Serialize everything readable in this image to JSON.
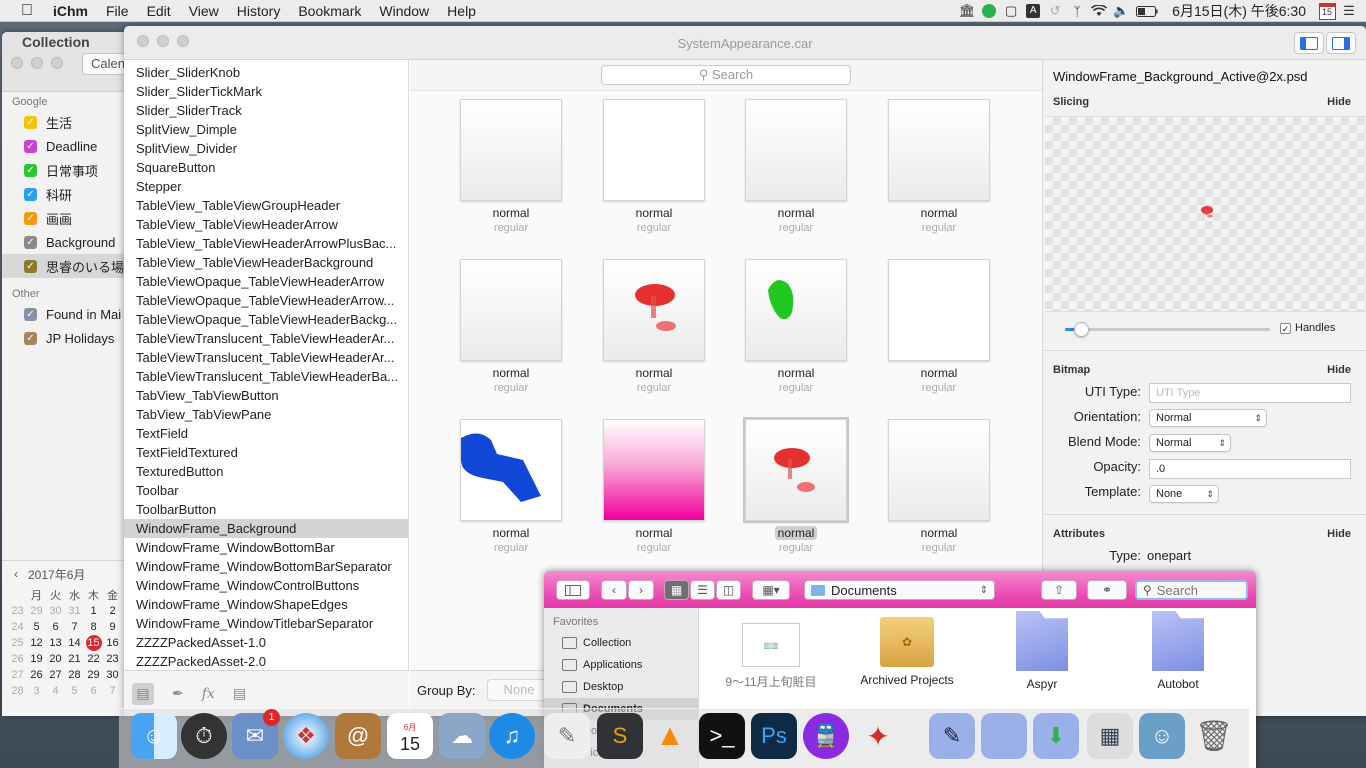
{
  "menubar": {
    "app_name": "iChm",
    "items": [
      "File",
      "Edit",
      "View",
      "History",
      "Bookmark",
      "Window",
      "Help"
    ],
    "clock": "6月15日(木) 午後6:30",
    "calendar_day": "15"
  },
  "calendar": {
    "collection_label": "Collection",
    "toolbar_button": "Calen",
    "google_group": "Google",
    "google_items": [
      {
        "label": "生活",
        "color": "#f5c400"
      },
      {
        "label": "Deadline",
        "color": "#c643d4"
      },
      {
        "label": "日常事项",
        "color": "#2ec42e"
      },
      {
        "label": "科研",
        "color": "#2b9ef0"
      },
      {
        "label": "画画",
        "color": "#f59a0c"
      },
      {
        "label": "Background",
        "color": "#8a8a8a"
      },
      {
        "label": "思睿のいる場所",
        "color": "#8a7a2a"
      }
    ],
    "other_group": "Other",
    "other_items": [
      {
        "label": "Found in Mai",
        "color": "#8a8fa8"
      },
      {
        "label": "JP Holidays",
        "color": "#a7845a"
      }
    ],
    "month_label": "2017年6月",
    "weekdays": [
      "月",
      "火",
      "水",
      "木",
      "金"
    ],
    "weeks": [
      [
        "29",
        "30",
        "31",
        "1",
        "2"
      ],
      [
        "5",
        "6",
        "7",
        "8",
        "9"
      ],
      [
        "12",
        "13",
        "14",
        "15",
        "16"
      ],
      [
        "19",
        "20",
        "21",
        "22",
        "23"
      ],
      [
        "26",
        "27",
        "28",
        "29",
        "30"
      ],
      [
        "3",
        "4",
        "5",
        "6",
        "7"
      ]
    ],
    "week_numbers": [
      "23",
      "24",
      "25",
      "26",
      "27",
      "28"
    ],
    "today": "15"
  },
  "window": {
    "title": "SystemAppearance.car",
    "search_placeholder": "Search",
    "assets": [
      "Slider_SliderKnob",
      "Slider_SliderTickMark",
      "Slider_SliderTrack",
      "SplitView_Dimple",
      "SplitView_Divider",
      "SquareButton",
      "Stepper",
      "TableView_TableViewGroupHeader",
      "TableView_TableViewHeaderArrow",
      "TableView_TableViewHeaderArrowPlusBac...",
      "TableView_TableViewHeaderBackground",
      "TableViewOpaque_TableViewHeaderArrow",
      "TableViewOpaque_TableViewHeaderArrow...",
      "TableViewOpaque_TableViewHeaderBackg...",
      "TableViewTranslucent_TableViewHeaderAr...",
      "TableViewTranslucent_TableViewHeaderAr...",
      "TableViewTranslucent_TableViewHeaderBa...",
      "TabView_TabViewButton",
      "TabView_TabViewPane",
      "TextField",
      "TextFieldTextured",
      "TexturedButton",
      "Toolbar",
      "ToolbarButton",
      "WindowFrame_Background",
      "WindowFrame_WindowBottomBar",
      "WindowFrame_WindowBottomBarSeparator",
      "WindowFrame_WindowControlButtons",
      "WindowFrame_WindowShapeEdges",
      "WindowFrame_WindowTitlebarSeparator",
      "ZZZZPackedAsset-1.0",
      "ZZZZPackedAsset-2.0"
    ],
    "selected_asset": "WindowFrame_Background",
    "grid": [
      {
        "name": "normal",
        "sub": "regular",
        "kind": "grad"
      },
      {
        "name": "normal",
        "sub": "regular",
        "kind": "white"
      },
      {
        "name": "normal",
        "sub": "regular",
        "kind": "grad"
      },
      {
        "name": "normal",
        "sub": "regular",
        "kind": "grad"
      },
      {
        "name": "normal",
        "sub": "regular",
        "kind": "grad"
      },
      {
        "name": "normal",
        "sub": "regular",
        "kind": "red"
      },
      {
        "name": "normal",
        "sub": "regular",
        "kind": "green"
      },
      {
        "name": "normal",
        "sub": "regular",
        "kind": "white"
      },
      {
        "name": "normal",
        "sub": "regular",
        "kind": "blue"
      },
      {
        "name": "normal",
        "sub": "regular",
        "kind": "pink"
      },
      {
        "name": "normal",
        "sub": "regular",
        "kind": "redsel"
      },
      {
        "name": "normal",
        "sub": "regular",
        "kind": "grad"
      }
    ],
    "group_by_label": "Group By:",
    "group_by_value": "None"
  },
  "inspector": {
    "filename": "WindowFrame_Background_Active@2x.psd",
    "slicing_label": "Slicing",
    "hide_label": "Hide",
    "handles_label": "Handles",
    "slider_level": 0.08,
    "bitmap_label": "Bitmap",
    "uti_label": "UTI Type:",
    "uti_placeholder": "UTI Type",
    "orientation_label": "Orientation:",
    "orientation_value": "Normal",
    "blend_label": "Blend Mode:",
    "blend_value": "Normal",
    "opacity_label": "Opacity:",
    "opacity_value": ".0",
    "template_label": "Template:",
    "template_value": "None",
    "attributes_label": "Attributes",
    "type_label": "Type:",
    "type_value": "onepart"
  },
  "finder": {
    "path": "Documents",
    "search_placeholder": "Search",
    "favorites_label": "Favorites",
    "sidebar": [
      "Collection",
      "Applications",
      "Desktop",
      "Documents",
      "Downloads",
      "Pictures"
    ],
    "selected": "Documents",
    "items": [
      {
        "label": "9〜11月上旬賍目",
        "dim": true
      },
      {
        "label": "Archived Projects",
        "dim": false
      },
      {
        "label": "Aspyr",
        "dim": false
      },
      {
        "label": "Autobot",
        "dim": false
      }
    ]
  },
  "dock": {
    "mail_badge": "1",
    "calendar_month": "6月",
    "calendar_day": "15"
  },
  "colors": {
    "finder_toolbar": "#ea47b0",
    "accent_blue": "#3b82f5",
    "today_red": "#e0262a"
  }
}
